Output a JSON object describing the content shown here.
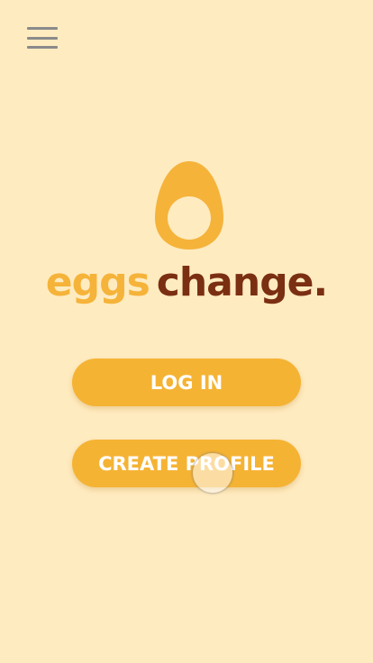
{
  "header": {
    "menu_icon": "hamburger-menu-icon"
  },
  "brand": {
    "logo_icon": "egg-icon",
    "word_1": "eggs",
    "word_2": "change.",
    "colors": {
      "primary": "#F5B33A",
      "secondary": "#7A2E12",
      "background": "#FFEBC0"
    }
  },
  "actions": {
    "login_label": "LOG IN",
    "create_profile_label": "CREATE PROFILE"
  }
}
